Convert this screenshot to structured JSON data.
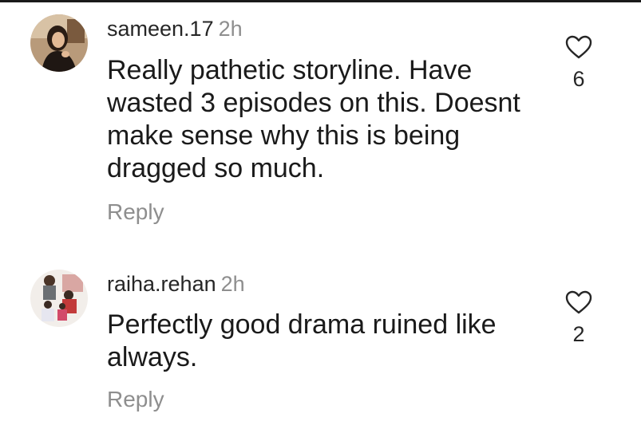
{
  "comments": [
    {
      "username": "sameen.17",
      "time": "2h",
      "text": "Really pathetic storyline. Have wasted 3 episodes on this. Doesnt make sense why this is being dragged so much.",
      "reply_label": "Reply",
      "likes": "6",
      "avatar_icon": "user-photo"
    },
    {
      "username": "raiha.rehan",
      "time": "2h",
      "text": "Perfectly good drama ruined like always.",
      "reply_label": "Reply",
      "likes": "2",
      "avatar_icon": "user-photo"
    }
  ],
  "colors": {
    "text_primary": "#262626",
    "text_secondary": "#8e8e8e",
    "background": "#ffffff"
  }
}
